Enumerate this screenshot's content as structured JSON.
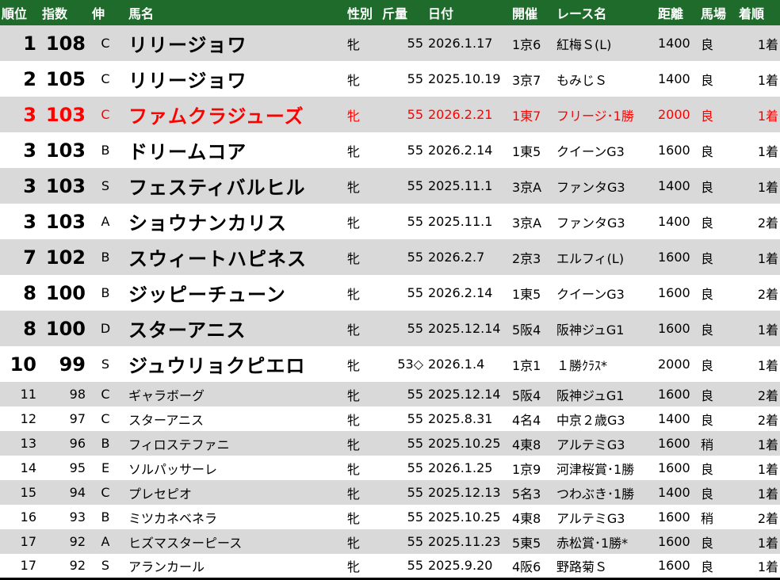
{
  "header": {
    "rank": "順位",
    "index": "指数",
    "nobi": "伸",
    "horse": "馬名",
    "sex": "性別",
    "weight": "斤量",
    "date": "日付",
    "venue": "開催",
    "race": "レース名",
    "distance": "距離",
    "track": "馬場",
    "finish": "着順"
  },
  "rows": [
    {
      "rank": "1",
      "index": "108",
      "nobi": "C",
      "horse": "リリージョワ",
      "sex": "牝",
      "weight": "55",
      "date": "2026.1.17",
      "venue": "1京6",
      "race": "紅梅Ｓ(L)",
      "distance": "1400",
      "track": "良",
      "finish": "1着"
    },
    {
      "rank": "2",
      "index": "105",
      "nobi": "C",
      "horse": "リリージョワ",
      "sex": "牝",
      "weight": "55",
      "date": "2025.10.19",
      "venue": "3京7",
      "race": "もみじＳ",
      "distance": "1400",
      "track": "良",
      "finish": "1着"
    },
    {
      "rank": "3",
      "index": "103",
      "nobi": "C",
      "horse": "ファムクラジューズ",
      "sex": "牝",
      "weight": "55",
      "date": "2026.2.21",
      "venue": "1東7",
      "race": "フリージ･1勝",
      "distance": "2000",
      "track": "良",
      "finish": "1着"
    },
    {
      "rank": "3",
      "index": "103",
      "nobi": "B",
      "horse": "ドリームコア",
      "sex": "牝",
      "weight": "55",
      "date": "2026.2.14",
      "venue": "1東5",
      "race": "クイーンG3",
      "distance": "1600",
      "track": "良",
      "finish": "1着"
    },
    {
      "rank": "3",
      "index": "103",
      "nobi": "S",
      "horse": "フェスティバルヒル",
      "sex": "牝",
      "weight": "55",
      "date": "2025.11.1",
      "venue": "3京A",
      "race": "ファンタG3",
      "distance": "1400",
      "track": "良",
      "finish": "1着"
    },
    {
      "rank": "3",
      "index": "103",
      "nobi": "A",
      "horse": "ショウナンカリス",
      "sex": "牝",
      "weight": "55",
      "date": "2025.11.1",
      "venue": "3京A",
      "race": "ファンタG3",
      "distance": "1400",
      "track": "良",
      "finish": "2着"
    },
    {
      "rank": "7",
      "index": "102",
      "nobi": "B",
      "horse": "スウィートハピネス",
      "sex": "牝",
      "weight": "55",
      "date": "2026.2.7",
      "venue": "2京3",
      "race": "エルフィ(L)",
      "distance": "1600",
      "track": "良",
      "finish": "1着"
    },
    {
      "rank": "8",
      "index": "100",
      "nobi": "B",
      "horse": "ジッピーチューン",
      "sex": "牝",
      "weight": "55",
      "date": "2026.2.14",
      "venue": "1東5",
      "race": "クイーンG3",
      "distance": "1600",
      "track": "良",
      "finish": "2着"
    },
    {
      "rank": "8",
      "index": "100",
      "nobi": "D",
      "horse": "スターアニス",
      "sex": "牝",
      "weight": "55",
      "date": "2025.12.14",
      "venue": "5阪4",
      "race": "阪神ジュG1",
      "distance": "1600",
      "track": "良",
      "finish": "1着"
    },
    {
      "rank": "10",
      "index": "99",
      "nobi": "S",
      "horse": "ジュウリョクピエロ",
      "sex": "牝",
      "weight": "53◇",
      "date": "2026.1.4",
      "venue": "1京1",
      "race": "１勝ｸﾗｽ*",
      "distance": "2000",
      "track": "良",
      "finish": "1着"
    },
    {
      "rank": "11",
      "index": "98",
      "nobi": "C",
      "horse": "ギャラボーグ",
      "sex": "牝",
      "weight": "55",
      "date": "2025.12.14",
      "venue": "5阪4",
      "race": "阪神ジュG1",
      "distance": "1600",
      "track": "良",
      "finish": "2着"
    },
    {
      "rank": "12",
      "index": "97",
      "nobi": "C",
      "horse": "スターアニス",
      "sex": "牝",
      "weight": "55",
      "date": "2025.8.31",
      "venue": "4名4",
      "race": "中京２歳G3",
      "distance": "1400",
      "track": "良",
      "finish": "2着"
    },
    {
      "rank": "13",
      "index": "96",
      "nobi": "B",
      "horse": "フィロステファニ",
      "sex": "牝",
      "weight": "55",
      "date": "2025.10.25",
      "venue": "4東8",
      "race": "アルテミG3",
      "distance": "1600",
      "track": "稍",
      "finish": "1着"
    },
    {
      "rank": "14",
      "index": "95",
      "nobi": "E",
      "horse": "ソルパッサーレ",
      "sex": "牝",
      "weight": "55",
      "date": "2026.1.25",
      "venue": "1京9",
      "race": "河津桜賞･1勝",
      "distance": "1600",
      "track": "良",
      "finish": "1着"
    },
    {
      "rank": "15",
      "index": "94",
      "nobi": "C",
      "horse": "プレセピオ",
      "sex": "牝",
      "weight": "55",
      "date": "2025.12.13",
      "venue": "5名3",
      "race": "つわぶき･1勝",
      "distance": "1400",
      "track": "良",
      "finish": "1着"
    },
    {
      "rank": "16",
      "index": "93",
      "nobi": "B",
      "horse": "ミツカネベネラ",
      "sex": "牝",
      "weight": "55",
      "date": "2025.10.25",
      "venue": "4東8",
      "race": "アルテミG3",
      "distance": "1600",
      "track": "稍",
      "finish": "2着"
    },
    {
      "rank": "17",
      "index": "92",
      "nobi": "A",
      "horse": "ヒズマスターピース",
      "sex": "牝",
      "weight": "55",
      "date": "2025.11.23",
      "venue": "5東5",
      "race": "赤松賞･1勝*",
      "distance": "1600",
      "track": "良",
      "finish": "1着"
    },
    {
      "rank": "17",
      "index": "92",
      "nobi": "S",
      "horse": "アランカール",
      "sex": "牝",
      "weight": "55",
      "date": "2025.9.20",
      "venue": "4阪6",
      "race": "野路菊Ｓ",
      "distance": "1600",
      "track": "良",
      "finish": "1着"
    }
  ],
  "colors": {
    "header_bg": "#1e6b2b",
    "header_text": "#ffffff",
    "row_grey": "#d9d9d9",
    "row_white": "#ffffff",
    "highlight_text": "#ff0000"
  }
}
